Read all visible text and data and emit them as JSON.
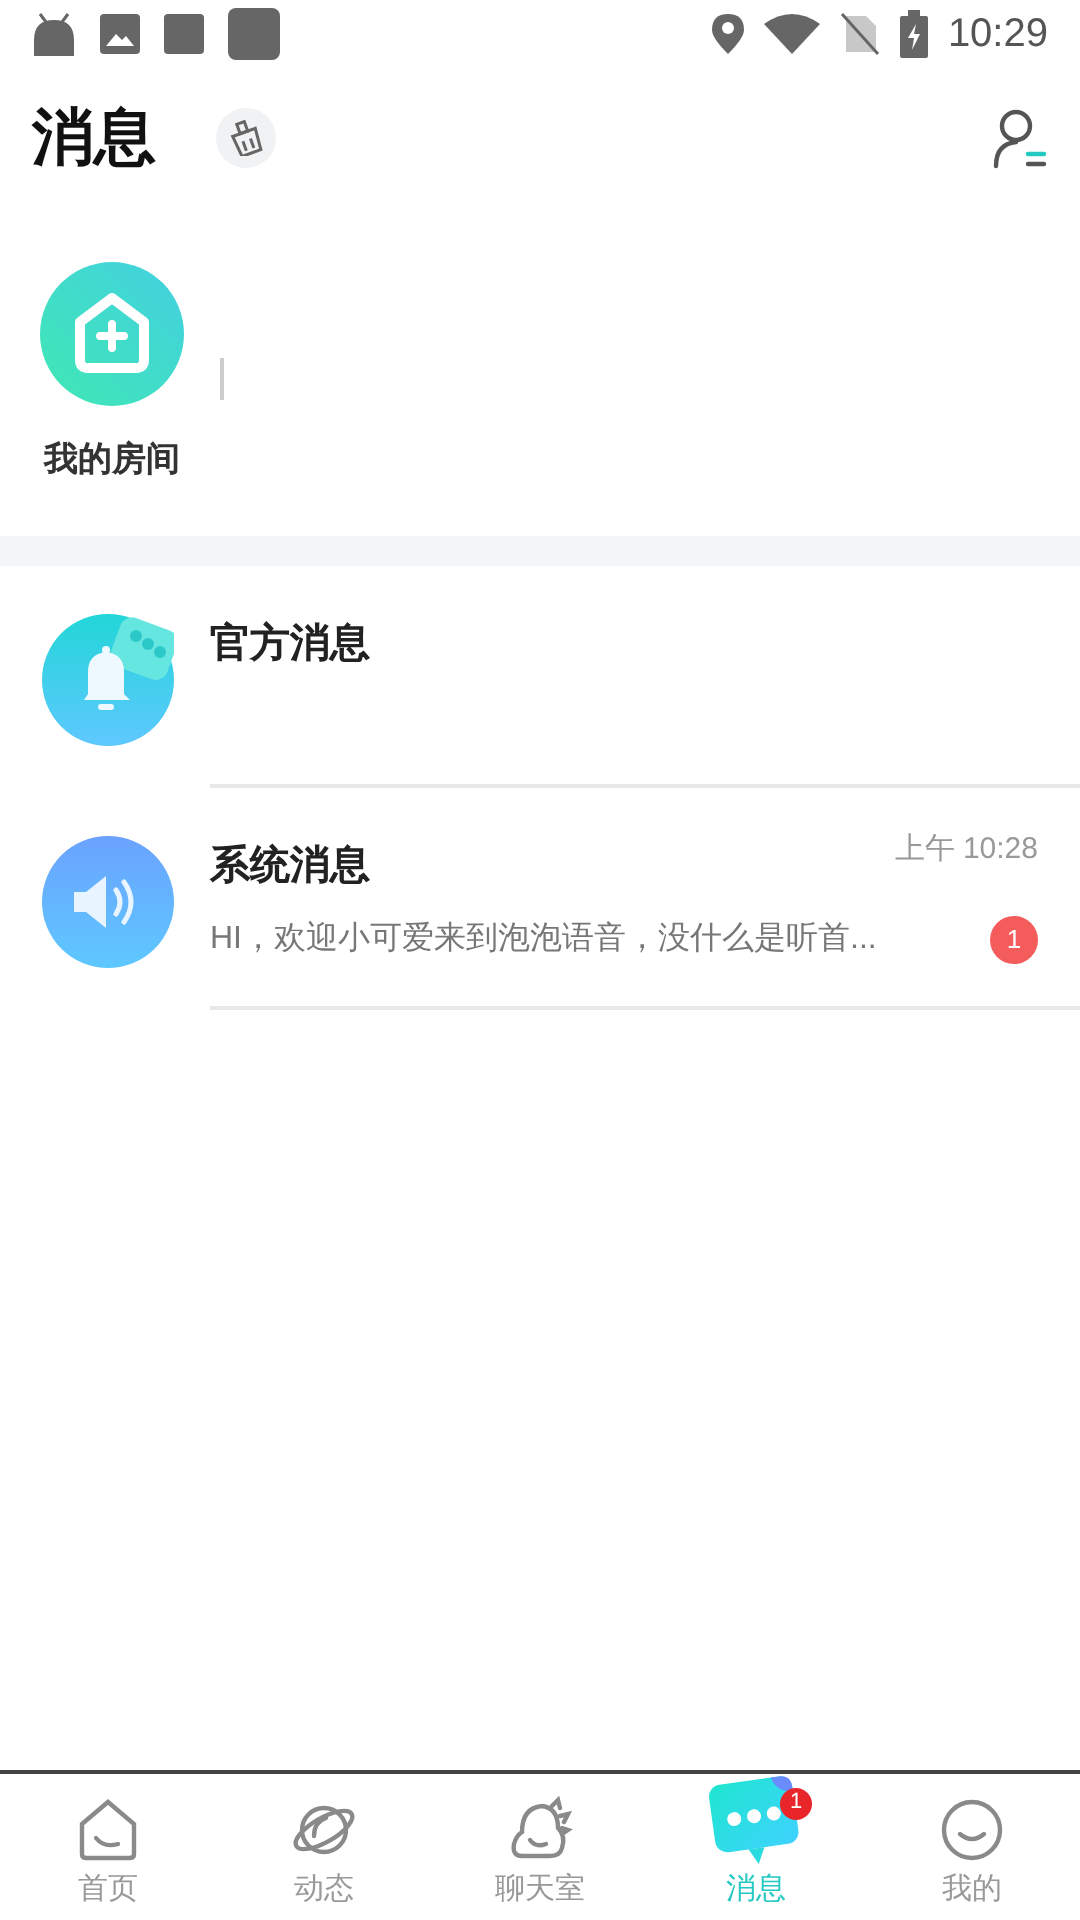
{
  "status_bar": {
    "time": "10:29"
  },
  "header": {
    "title": "消息"
  },
  "rooms": [
    {
      "label": "我的房间"
    }
  ],
  "conversations": [
    {
      "kind": "official",
      "title": "官方消息"
    },
    {
      "kind": "system",
      "title": "系统消息",
      "time": "上午 10:28",
      "preview": "HI，欢迎小可爱来到泡泡语音，没什么是听首...",
      "unread": "1"
    }
  ],
  "tabs": [
    {
      "kind": "home",
      "label": "首页",
      "selected": false
    },
    {
      "kind": "planet",
      "label": "动态",
      "selected": false
    },
    {
      "kind": "dino",
      "label": "聊天室",
      "selected": false
    },
    {
      "kind": "message",
      "label": "消息",
      "selected": true,
      "badge": "1"
    },
    {
      "kind": "smile",
      "label": "我的",
      "selected": false
    }
  ]
}
